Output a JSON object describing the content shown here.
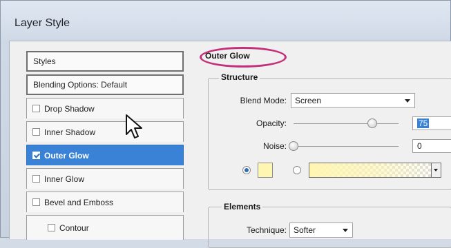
{
  "window": {
    "title": "Layer Style"
  },
  "styles_list": {
    "items": [
      {
        "label": "Styles",
        "kind": "header"
      },
      {
        "label": "Blending Options: Default",
        "kind": "header"
      },
      {
        "label": "Drop Shadow",
        "checked": false
      },
      {
        "label": "Inner Shadow",
        "checked": false
      },
      {
        "label": "Outer Glow",
        "checked": true,
        "selected": true
      },
      {
        "label": "Inner Glow",
        "checked": false
      },
      {
        "label": "Bevel and Emboss",
        "checked": false
      },
      {
        "label": "Contour",
        "checked": false,
        "indent": true
      }
    ]
  },
  "panel": {
    "title": "Outer Glow",
    "structure": {
      "label": "Structure",
      "blend_mode_label": "Blend Mode:",
      "blend_mode_value": "Screen",
      "opacity_label": "Opacity:",
      "opacity_value": "75",
      "opacity_level": 0.75,
      "noise_label": "Noise:",
      "noise_value": "0",
      "noise_level": 0,
      "color_mode": "solid",
      "glow_color": "#fff6b2"
    },
    "elements": {
      "label": "Elements",
      "technique_label": "Technique:",
      "technique_value": "Softer"
    }
  },
  "colors": {
    "selection": "#3a82d6",
    "highlight_circle": "#c2307c"
  }
}
